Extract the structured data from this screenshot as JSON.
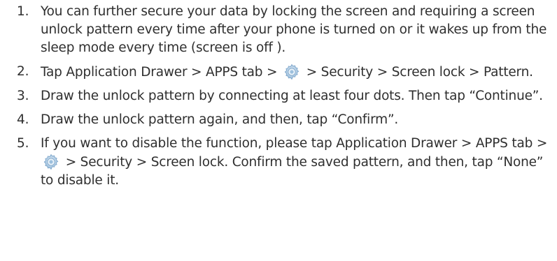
{
  "steps": [
    {
      "number": "1.",
      "text": "You can further secure your data by locking the screen and requiring a screen unlock pattern every time after your phone is turned on or it wakes up from the sleep mode every time (screen is off )."
    },
    {
      "number": "2.",
      "before_icon": "Tap Application Drawer > APPS tab >",
      "icon": "settings-gear-icon",
      "after_icon": "> Security > Screen lock > Pattern."
    },
    {
      "number": "3.",
      "text": "Draw the unlock pattern by connecting at least four dots. Then tap “Continue”."
    },
    {
      "number": "4.",
      "text": "Draw the unlock pattern again, and then, tap “Confirm”."
    },
    {
      "number": "5.",
      "before_icon": "If you want to disable the function, please tap Application Drawer > APPS tab >",
      "icon": "settings-gear-icon",
      "after_icon": "> Security > Screen lock. Confirm the saved pattern, and then, tap “None” to disable it."
    }
  ],
  "colors": {
    "text": "#2f2f2f",
    "icon_primary": "#8fb6d8",
    "icon_secondary": "#d7e6f2"
  }
}
